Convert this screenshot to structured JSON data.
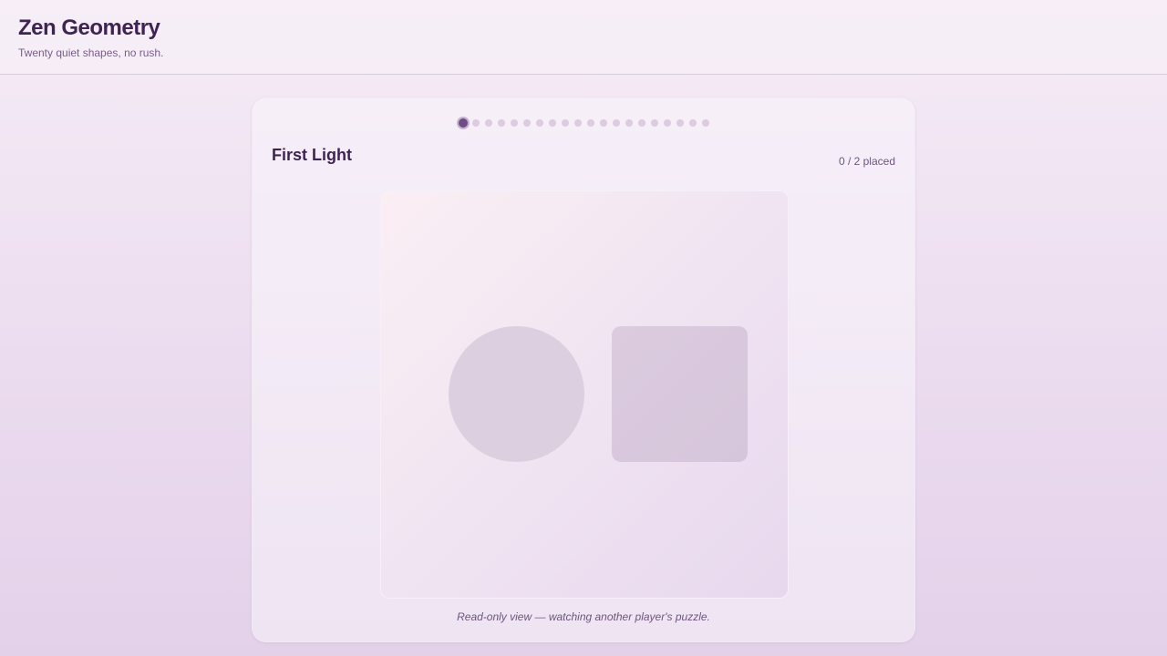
{
  "header": {
    "title": "Zen Geometry",
    "subtitle": "Twenty quiet shapes, no rush."
  },
  "progress": {
    "total_levels": 20,
    "current_level": 1
  },
  "level": {
    "title": "First Light",
    "placed_count": "0 / 2 placed",
    "shapes": [
      {
        "type": "circle",
        "state": "target-outline"
      },
      {
        "type": "rounded-square",
        "state": "target-outline"
      }
    ]
  },
  "footer": {
    "note": "Read-only view — watching another player's puzzle."
  },
  "colors": {
    "accent": "#6e4d86",
    "dot_inactive": "#dccbe1",
    "title_text": "#3f2352",
    "shape_fill": "#dccfdf"
  }
}
